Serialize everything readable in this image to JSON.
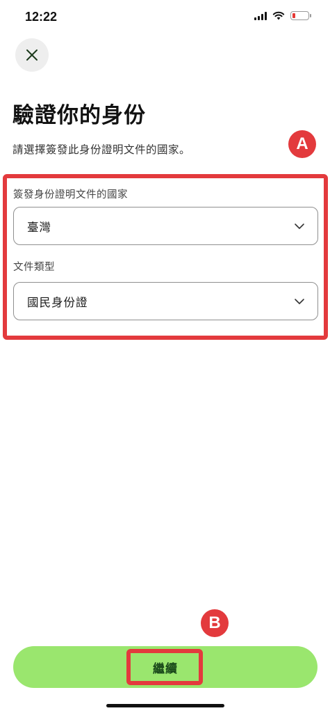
{
  "status_bar": {
    "time": "12:22",
    "icons": [
      "signal-icon",
      "wifi-icon",
      "battery-low-icon"
    ],
    "battery_color": "#e53935"
  },
  "header": {
    "close_icon": "close-icon"
  },
  "page": {
    "title": "驗證你的身份",
    "subtitle": "請選擇簽發此身份證明文件的國家。"
  },
  "form": {
    "country": {
      "label": "簽發身份證明文件的國家",
      "value": "臺灣",
      "icon": "chevron-down-icon"
    },
    "document_type": {
      "label": "文件類型",
      "value": "國民身份證",
      "icon": "chevron-down-icon"
    }
  },
  "annotations": {
    "marker_a": "A",
    "marker_b": "B",
    "color": "#e33a3d"
  },
  "footer": {
    "continue_label": "繼續",
    "button_color": "#9ae66e"
  }
}
